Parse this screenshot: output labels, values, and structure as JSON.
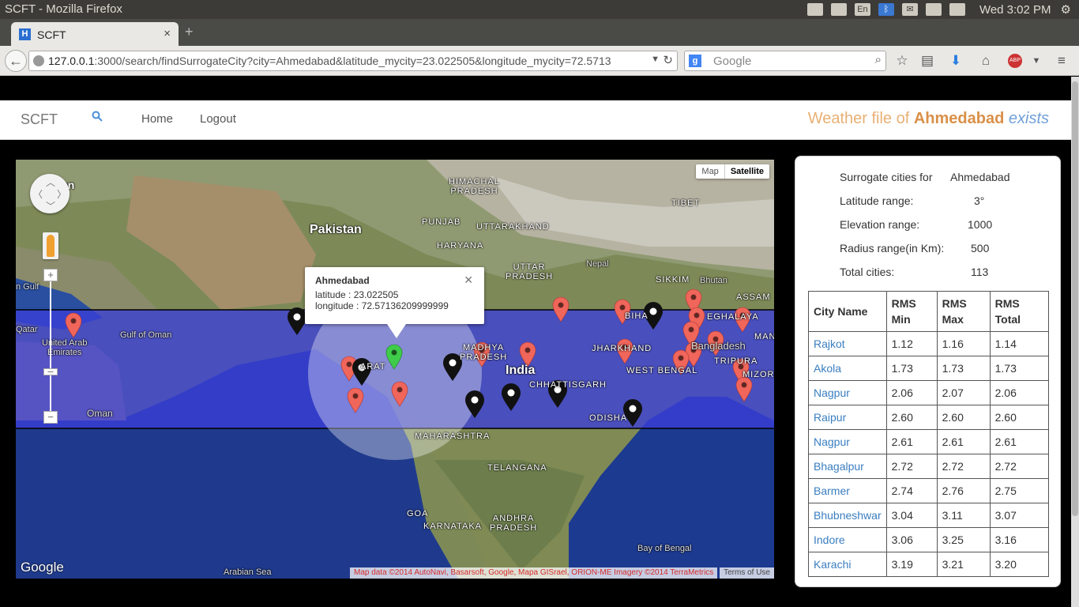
{
  "os": {
    "window_title": "SCFT - Mozilla Firefox",
    "tray_lang": "En",
    "clock": "Wed  3:02 PM"
  },
  "browser": {
    "tab_title": "SCFT",
    "favicon_letter": "H",
    "url_host": "127.0.0.1",
    "url_rest": ":3000/search/findSurrogateCity?city=Ahmedabad&latitude_mycity=23.022505&longitude_mycity=72.5713",
    "search_placeholder": "Google",
    "search_engine_letter": "g",
    "adblock_label": "ABP"
  },
  "app": {
    "brand": "SCFT",
    "nav_home": "Home",
    "nav_logout": "Logout",
    "weather_prefix": "Weather file of ",
    "weather_city": "Ahmedabad",
    "weather_suffix": "exists"
  },
  "map": {
    "type_map": "Map",
    "type_satellite": "Satellite",
    "google_logo": "Google",
    "attribution": "Map data ©2014 AutoNavi, Basarsoft, Google, Mapa GISrael, ORION-ME Imagery ©2014 TerraMetrics",
    "terms": "Terms of Use",
    "labels": {
      "pakistan": "Pakistan",
      "india": "India",
      "himachal": "HIMACHAL\nPRADESH",
      "punjab": "PUNJAB",
      "uttarakhand": "UTTARAKHAND",
      "haryana": "HARYANA",
      "uttar": "UTTAR\nPRADESH",
      "nepal": "Nepal",
      "tibet": "TIBET",
      "sikkim": "SIKKIM",
      "bhutan": "Bhutan",
      "assam": "ASSAM",
      "bihar": "BIHA",
      "meghalaya": "EGHALAYA",
      "manipur": "MAN",
      "jharkhand": "JHARKHAND",
      "westbengal": "WEST BENGAL",
      "bangladesh": "Bangladesh",
      "tripura": "TRIPURA",
      "mizoram": "MIZORA",
      "chhattisgarh": "CHHATTISGARH",
      "madhya": "MADHYA\nPRADESH",
      "gujarat": "ARAT",
      "odisha": "ODISHA",
      "maharashtra": "MAHARASHTRA",
      "telangana": "TELANGANA",
      "goa": "GOA",
      "karnataka": "KARNATAKA",
      "andhra": "ANDHRA\nPRADESH",
      "bayofbengal": "Bay of Bengal",
      "arabiansea": "Arabian Sea",
      "uae": "United Arab\nEmirates",
      "qatar": "Qatar",
      "oman": "Oman",
      "gulfofoman": "Gulf of Oman",
      "gulf": "n Gulf",
      "topleft": "an"
    },
    "infowindow": {
      "title": "Ahmedabad",
      "latitude": "latitude : 23.022505",
      "longitude": "longitude : 72.57136209999999"
    },
    "colors": {
      "band": "#3b3fd8",
      "pin_red": "#f0665a",
      "pin_black": "#111111",
      "pin_green": "#3fcc4a"
    }
  },
  "panel": {
    "surrogate_label": "Surrogate cities for",
    "surrogate_value": "Ahmedabad",
    "lat_label": "Latitude range:",
    "lat_value": "3°",
    "elev_label": "Elevation range:",
    "elev_value": "1000",
    "radius_label": "Radius range(in Km):",
    "radius_value": "500",
    "total_label": "Total cities:",
    "total_value": "113",
    "headers": [
      "City Name",
      "RMS Min",
      "RMS Max",
      "RMS Total"
    ],
    "rows": [
      [
        "Rajkot",
        "1.12",
        "1.16",
        "1.14"
      ],
      [
        "Akola",
        "1.73",
        "1.73",
        "1.73"
      ],
      [
        "Nagpur",
        "2.06",
        "2.07",
        "2.06"
      ],
      [
        "Raipur",
        "2.60",
        "2.60",
        "2.60"
      ],
      [
        "Nagpur",
        "2.61",
        "2.61",
        "2.61"
      ],
      [
        "Bhagalpur",
        "2.72",
        "2.72",
        "2.72"
      ],
      [
        "Barmer",
        "2.74",
        "2.76",
        "2.75"
      ],
      [
        "Bhubneshwar",
        "3.04",
        "3.11",
        "3.07"
      ],
      [
        "Indore",
        "3.06",
        "3.25",
        "3.16"
      ],
      [
        "Karachi",
        "3.19",
        "3.21",
        "3.20"
      ]
    ]
  }
}
